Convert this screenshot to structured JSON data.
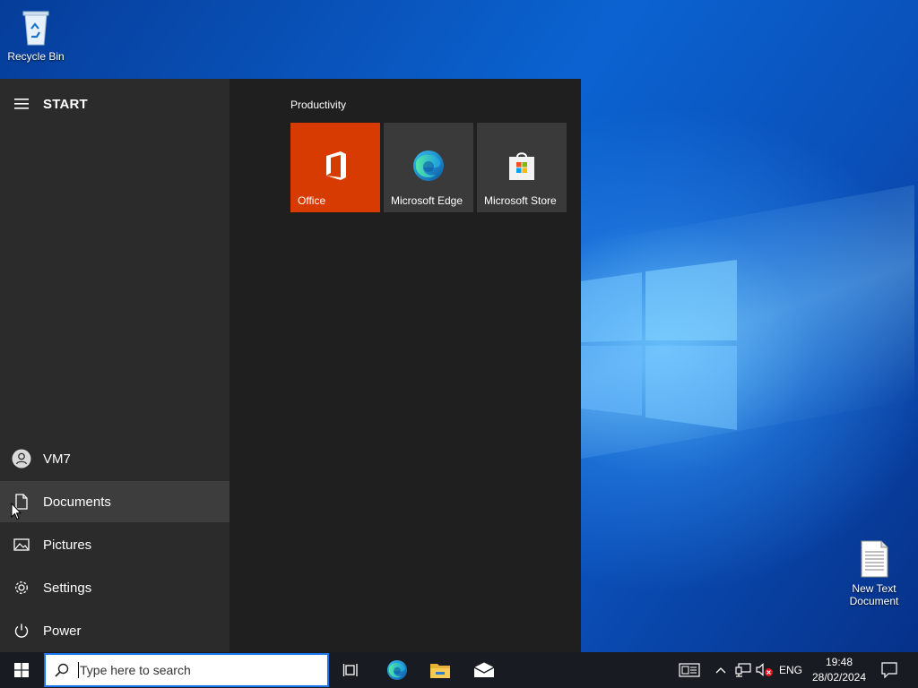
{
  "desktop": {
    "icons": [
      {
        "label": "Recycle Bin",
        "icon": "recycle-bin-icon"
      },
      {
        "label": "New Text Document",
        "icon": "text-document-icon"
      }
    ]
  },
  "start_menu": {
    "title": "START",
    "user": {
      "name": "VM7",
      "icon": "user-icon"
    },
    "left_items": [
      {
        "label": "Documents",
        "icon": "document-icon"
      },
      {
        "label": "Pictures",
        "icon": "pictures-icon"
      },
      {
        "label": "Settings",
        "icon": "gear-icon"
      },
      {
        "label": "Power",
        "icon": "power-icon"
      }
    ],
    "group": {
      "label": "Productivity",
      "tiles": [
        {
          "label": "Office",
          "icon": "office-icon",
          "color": "#d83b01"
        },
        {
          "label": "Microsoft Edge",
          "icon": "edge-icon",
          "color": "#3a3a3a"
        },
        {
          "label": "Microsoft Store",
          "icon": "store-icon",
          "color": "#3a3a3a"
        }
      ]
    }
  },
  "taskbar": {
    "search": {
      "placeholder": "Type here to search",
      "value": ""
    },
    "pinned": [
      {
        "name": "Task View",
        "icon": "task-view-icon"
      },
      {
        "name": "Microsoft Edge",
        "icon": "edge-icon"
      },
      {
        "name": "File Explorer",
        "icon": "folder-icon"
      },
      {
        "name": "Mail",
        "icon": "mail-icon"
      }
    ],
    "tray": {
      "language": "ENG",
      "time": "19:48",
      "date": "28/02/2024"
    }
  },
  "colors": {
    "taskbar": "#181c22",
    "start_left": "#2b2b2b",
    "start_right": "#1f1f1f",
    "office_tile": "#d83b01",
    "accent": "#1a73e8"
  }
}
